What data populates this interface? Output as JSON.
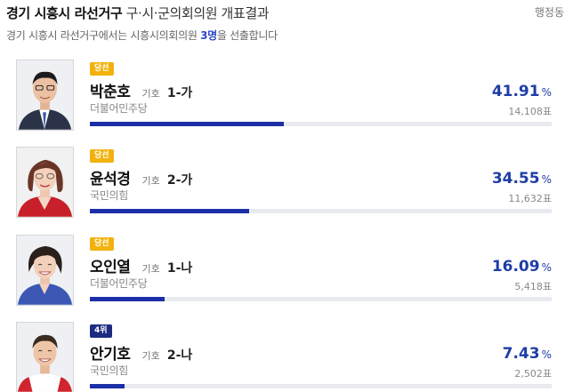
{
  "header": {
    "title_strong": "경기 시흥시 라선거구",
    "title_rest": "구·시·군의회의원 개표결과",
    "district_link": "행정동"
  },
  "description": {
    "prefix": "경기 시흥시 라선거구에서는 시흥시의회의원",
    "count": "3명",
    "suffix": "을 선출합니다"
  },
  "candidates": [
    {
      "badge": "당선",
      "badge_type": "elected",
      "name": "박춘호",
      "number_label": "기호",
      "number": "1-가",
      "party": "더불어민주당",
      "party_color": "#1e3da7",
      "rate": "41.91",
      "rate_unit": "%",
      "votes": "14,108표",
      "bar_fraction": 0.4191
    },
    {
      "badge": "당선",
      "badge_type": "elected",
      "name": "윤석경",
      "number_label": "기호",
      "number": "2-가",
      "party": "국민의힘",
      "party_color": "#e61e2b",
      "rate": "34.55",
      "rate_unit": "%",
      "votes": "11,632표",
      "bar_fraction": 0.3455
    },
    {
      "badge": "당선",
      "badge_type": "elected",
      "name": "오인열",
      "number_label": "기호",
      "number": "1-나",
      "party": "더불어민주당",
      "party_color": "#1e3da7",
      "rate": "16.09",
      "rate_unit": "%",
      "votes": "5,418표",
      "bar_fraction": 0.1609
    },
    {
      "badge": "4위",
      "badge_type": "rank",
      "name": "안기호",
      "number_label": "기호",
      "number": "2-나",
      "party": "국민의힘",
      "party_color": "#e61e2b",
      "rate": "7.43",
      "rate_unit": "%",
      "votes": "2,502표",
      "bar_fraction": 0.0743
    }
  ],
  "colors": {
    "accent": "#1e3da7",
    "bar": "#1b2fa6",
    "elected_badge": "#f2b20b",
    "rank_badge": "#1d2c80"
  }
}
